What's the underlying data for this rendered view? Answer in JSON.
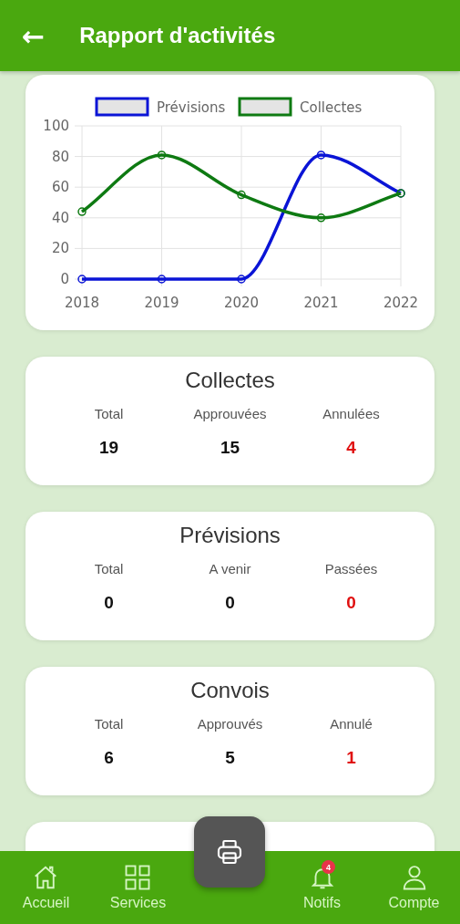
{
  "header": {
    "back": "←",
    "title": "Rapport d'activités"
  },
  "chart": {
    "chart_data": {
      "type": "line",
      "grid": true,
      "legend": "top",
      "categories": [
        "2018",
        "2019",
        "2020",
        "2021",
        "2022"
      ],
      "ylim": [
        0,
        100
      ],
      "yticks": [
        0,
        20,
        40,
        60,
        80,
        100
      ],
      "series": [
        {
          "name": "Prévisions",
          "color": "#0a14d6",
          "marker": "circle",
          "values": [
            0,
            0,
            0,
            81,
            56
          ]
        },
        {
          "name": "Collectes",
          "color": "#0e7a12",
          "marker": "circle",
          "values": [
            44,
            81,
            55,
            40,
            56
          ]
        }
      ]
    }
  },
  "cards": [
    {
      "title": "Collectes",
      "stats": [
        {
          "label": "Total",
          "value": "19",
          "alert": false
        },
        {
          "label": "Approuvées",
          "value": "15",
          "alert": false
        },
        {
          "label": "Annulées",
          "value": "4",
          "alert": true
        }
      ]
    },
    {
      "title": "Prévisions",
      "stats": [
        {
          "label": "Total",
          "value": "0",
          "alert": false
        },
        {
          "label": "A venir",
          "value": "0",
          "alert": false
        },
        {
          "label": "Passées",
          "value": "0",
          "alert": true
        }
      ]
    },
    {
      "title": "Convois",
      "stats": [
        {
          "label": "Total",
          "value": "6",
          "alert": false
        },
        {
          "label": "Approuvés",
          "value": "5",
          "alert": false
        },
        {
          "label": "Annulé",
          "value": "1",
          "alert": true
        }
      ]
    }
  ],
  "nav": [
    {
      "kind": "home",
      "label": "Accueil"
    },
    {
      "kind": "grid",
      "label": "Services"
    },
    {
      "kind": "bell",
      "label": "Notifs",
      "badge": "4"
    },
    {
      "kind": "user",
      "label": "Compte"
    }
  ]
}
